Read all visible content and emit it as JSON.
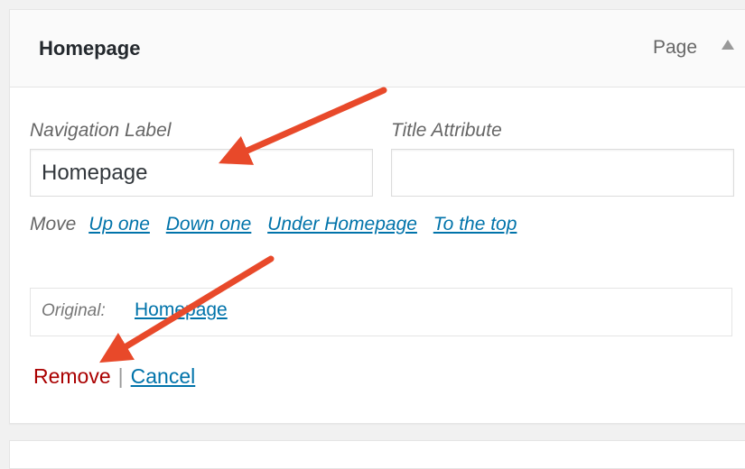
{
  "menu_item": {
    "title": "Homepage",
    "type": "Page",
    "toggle_icon": "arrow-up-icon"
  },
  "fields": {
    "navigation_label": "Navigation Label",
    "navigation_value": "Homepage",
    "title_attribute_label": "Title Attribute",
    "title_attribute_value": ""
  },
  "move": {
    "label": "Move",
    "links": [
      "Up one",
      "Down one",
      "Under Homepage",
      "To the top"
    ]
  },
  "original": {
    "label": "Original:",
    "link": "Homepage"
  },
  "actions": {
    "remove": "Remove",
    "separator": "|",
    "cancel": "Cancel"
  },
  "colors": {
    "annotation_arrow": "#e8492a",
    "link": "#0073aa",
    "remove": "#aa0000"
  }
}
